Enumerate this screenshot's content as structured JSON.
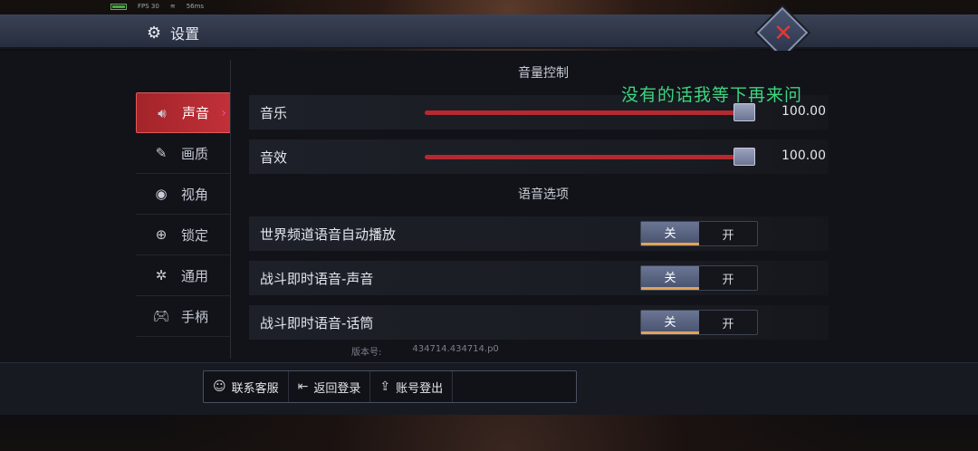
{
  "status": {
    "fps": "FPS 30",
    "ping": "56ms"
  },
  "header": {
    "title": "设置"
  },
  "sidebar": {
    "items": [
      {
        "label": "声音",
        "icon": "speaker-icon",
        "active": true
      },
      {
        "label": "画质",
        "icon": "palette-icon",
        "active": false
      },
      {
        "label": "视角",
        "icon": "eye-icon",
        "active": false
      },
      {
        "label": "锁定",
        "icon": "crosshair-icon",
        "active": false
      },
      {
        "label": "通用",
        "icon": "gear-icon",
        "active": false
      },
      {
        "label": "手柄",
        "icon": "gamepad-icon",
        "active": false
      }
    ]
  },
  "volume": {
    "section_title": "音量控制",
    "sliders": [
      {
        "label": "音乐",
        "value": "100.00",
        "fraction": 1.0
      },
      {
        "label": "音效",
        "value": "100.00",
        "fraction": 1.0
      }
    ]
  },
  "voice": {
    "section_title": "语音选项",
    "options": [
      {
        "label": "世界频道语音自动播放",
        "off": "关",
        "on": "开",
        "selected": "off"
      },
      {
        "label": "战斗即时语音-声音",
        "off": "关",
        "on": "开",
        "selected": "off"
      },
      {
        "label": "战斗即时语音-话筒",
        "off": "关",
        "on": "开",
        "selected": "off"
      }
    ]
  },
  "overlay_text": "没有的话我等下再来问",
  "version": {
    "label": "版本号:",
    "value": "434714.434714.p0"
  },
  "bottom": {
    "buttons": [
      {
        "label": "联系客服",
        "icon": "support-icon"
      },
      {
        "label": "返回登录",
        "icon": "return-icon"
      },
      {
        "label": "账号登出",
        "icon": "logout-icon"
      }
    ]
  },
  "colors": {
    "accent_red": "#c13038",
    "toggle_on": "#4b5570",
    "overlay_green": "#3cd680"
  }
}
